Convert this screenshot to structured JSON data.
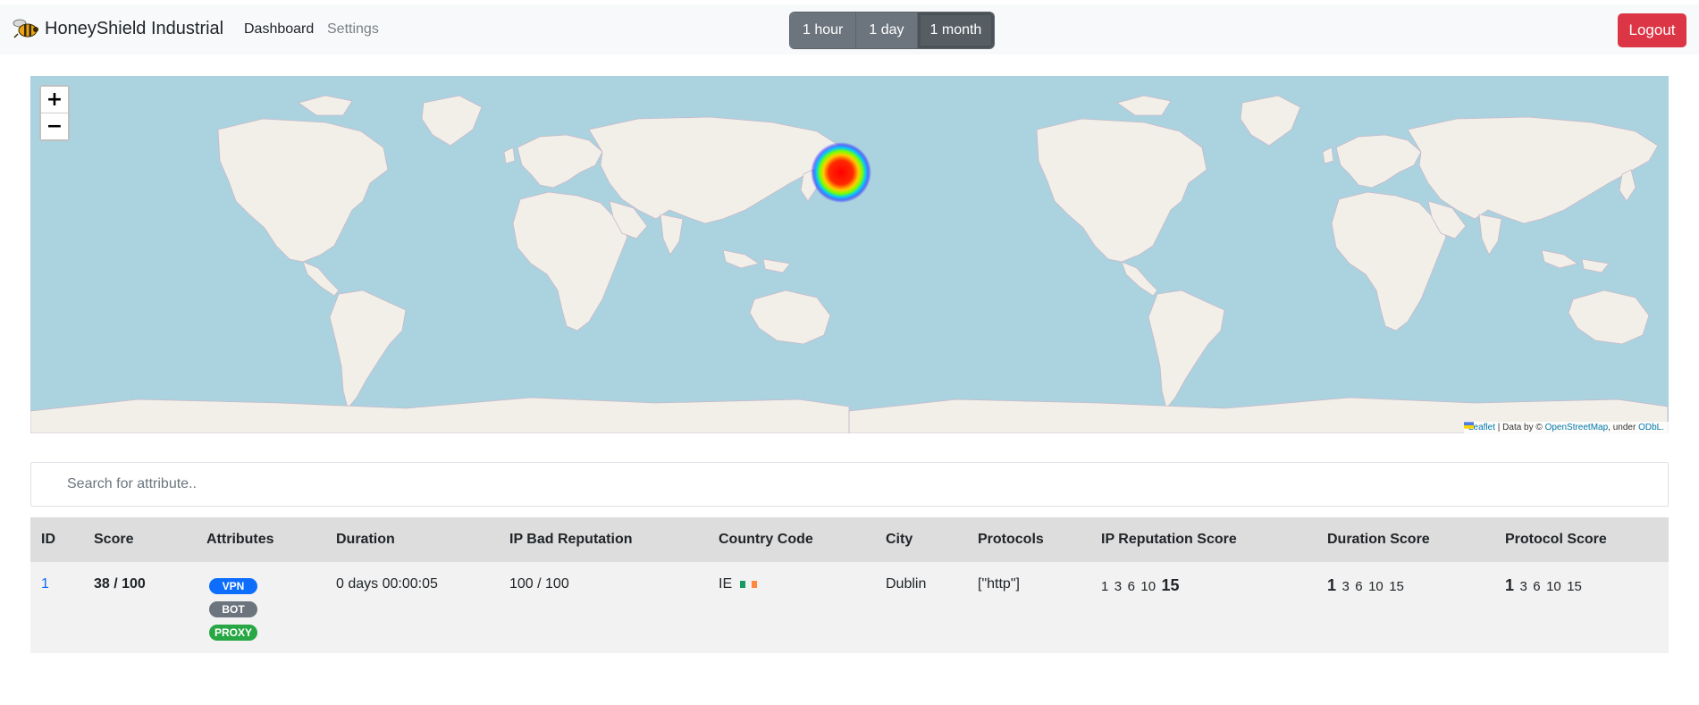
{
  "brand": {
    "name": "HoneyShield Industrial",
    "logo_icon": "bee-icon"
  },
  "nav": {
    "dashboard": "Dashboard",
    "settings": "Settings"
  },
  "range": {
    "options": [
      "1 hour",
      "1 day",
      "1 month"
    ],
    "selected": "1 month"
  },
  "logout_label": "Logout",
  "map": {
    "zoom_in": "+",
    "zoom_out": "−",
    "attribution": {
      "leaflet": "Leaflet",
      "data_by": "| Data by ©",
      "osm": "OpenStreetMap",
      "under": ", under",
      "license": "ODbL."
    },
    "heat_point": {
      "label": "Dublin, IE",
      "lat": 53.35,
      "lon": -6.26,
      "intensity": 1
    },
    "colors": {
      "ocean": "#aad3df",
      "land": "#f2efe9",
      "borders": "#c9b8c9"
    }
  },
  "search": {
    "placeholder": "Search for attribute.."
  },
  "table": {
    "headers": {
      "id": "ID",
      "score": "Score",
      "attributes": "Attributes",
      "duration": "Duration",
      "ip_bad_reputation": "IP Bad Reputation",
      "country_code": "Country Code",
      "city": "City",
      "protocols": "Protocols",
      "ip_reputation_score": "IP Reputation Score",
      "duration_score": "Duration Score",
      "protocol_score": "Protocol Score"
    },
    "rows": [
      {
        "id": "1",
        "score": "38 / 100",
        "attributes": [
          "VPN",
          "BOT",
          "PROXY"
        ],
        "duration": "0 days 00:00:05",
        "ip_bad_reputation": "100 / 100",
        "country_code": "IE",
        "flag_icon": "ireland-flag-icon",
        "city": "Dublin",
        "protocols": "[\"http\"]",
        "ip_reputation_scale": [
          "1",
          "3",
          "6",
          "10",
          "15"
        ],
        "ip_reputation_selected": "15",
        "duration_scale": [
          "1",
          "3",
          "6",
          "10",
          "15"
        ],
        "duration_selected": "1",
        "protocol_scale": [
          "1",
          "3",
          "6",
          "10",
          "15"
        ],
        "protocol_selected": "1"
      }
    ]
  },
  "colors": {
    "primary": "#0d6efd",
    "danger": "#dc3545",
    "secondary": "#6c757d",
    "success": "#28a745"
  }
}
